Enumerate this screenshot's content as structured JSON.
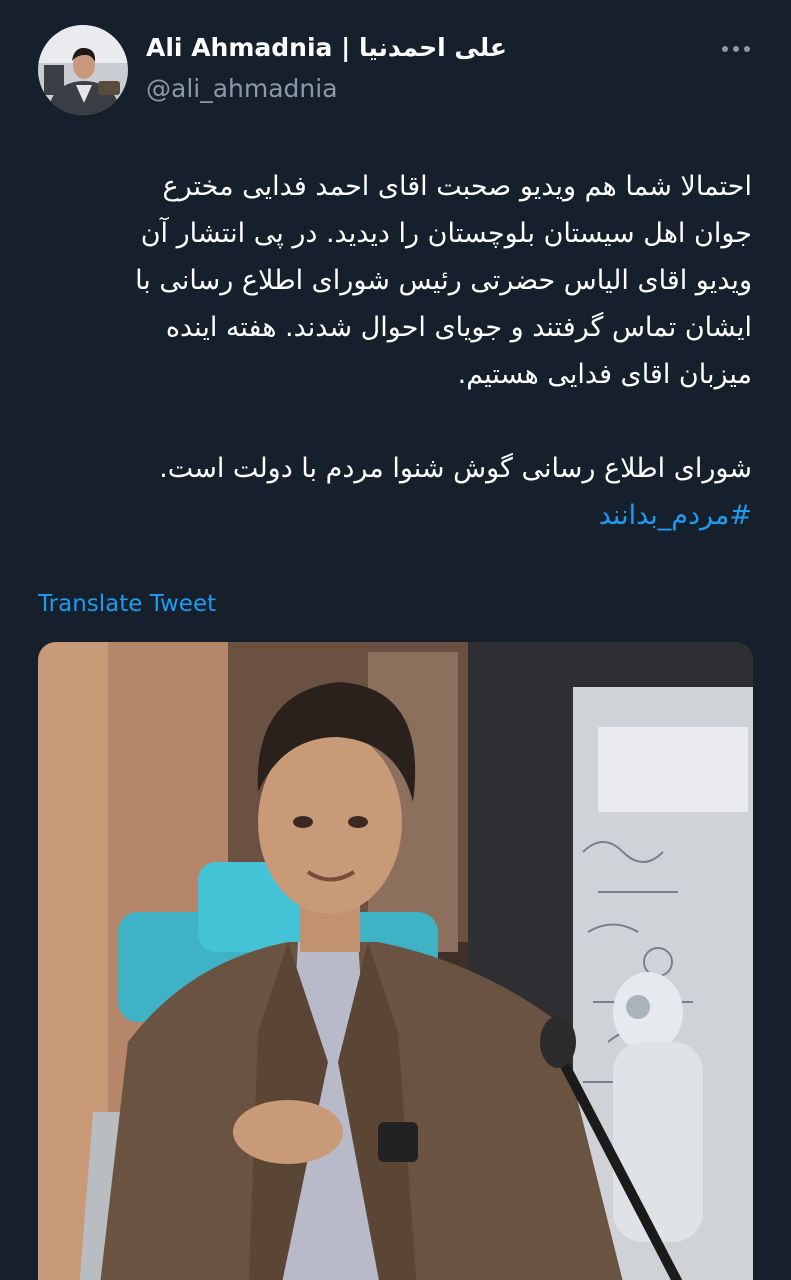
{
  "tweet": {
    "author": {
      "display_name": "Ali Ahmadnia | علی احمدنیا",
      "handle": "@ali_ahmadnia"
    },
    "more_icon": "more-dots-icon",
    "paragraph_1": "احتمالا شما هم ویدیو صحبت اقای احمد فدایی مخترع\nجوان اهل سیستان بلوچستان را دیدید. در پی انتشار آن\nویدیو اقای الیاس حضرتی رئیس شورای اطلاع رسانی با\nایشان تماس گرفتند و جویای احوال شدند. هفته اینده\nمیزبان اقای فدایی هستیم.",
    "paragraph_2": "شورای اطلاع رسانی گوش شنوا مردم با دولت است.",
    "hashtag": "#مردم_بدانند",
    "translate_label": "Translate Tweet",
    "media_icon": "video-frame-image"
  },
  "colors": {
    "background": "#16202c",
    "text": "#ffffff",
    "secondary_text": "#8b98a5",
    "accent": "#1d9bf0"
  }
}
